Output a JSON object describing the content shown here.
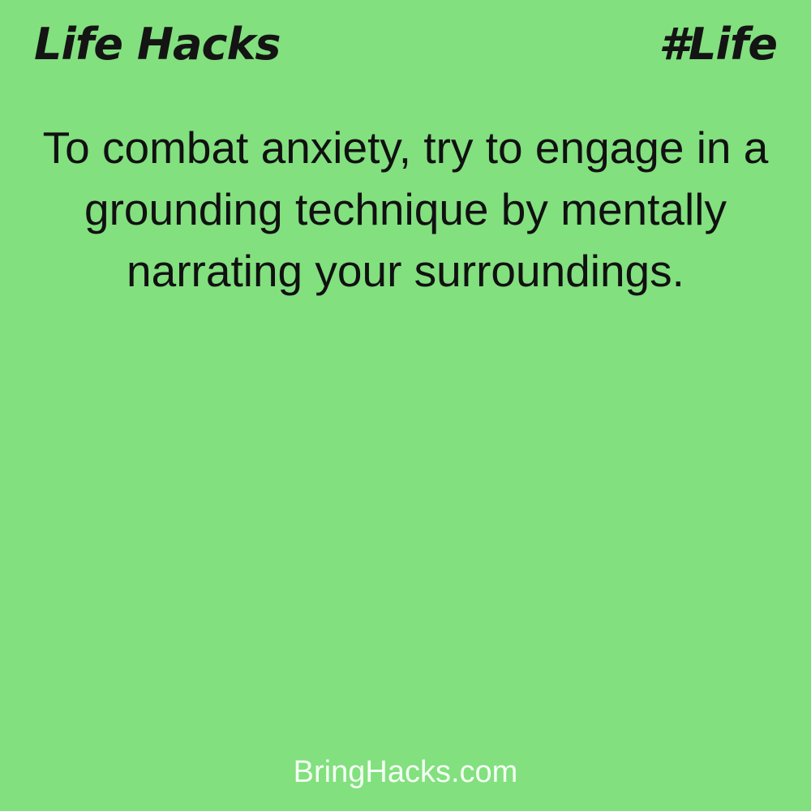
{
  "header": {
    "title": "Life Hacks",
    "tag": "#Life"
  },
  "content": {
    "quote": "To combat anxiety, try to engage in a grounding technique by mentally narrating your surroundings."
  },
  "footer": {
    "site": "BringHacks.com"
  },
  "colors": {
    "background": "#82e07f",
    "text": "#141414",
    "footer_text": "#f4fff3"
  }
}
